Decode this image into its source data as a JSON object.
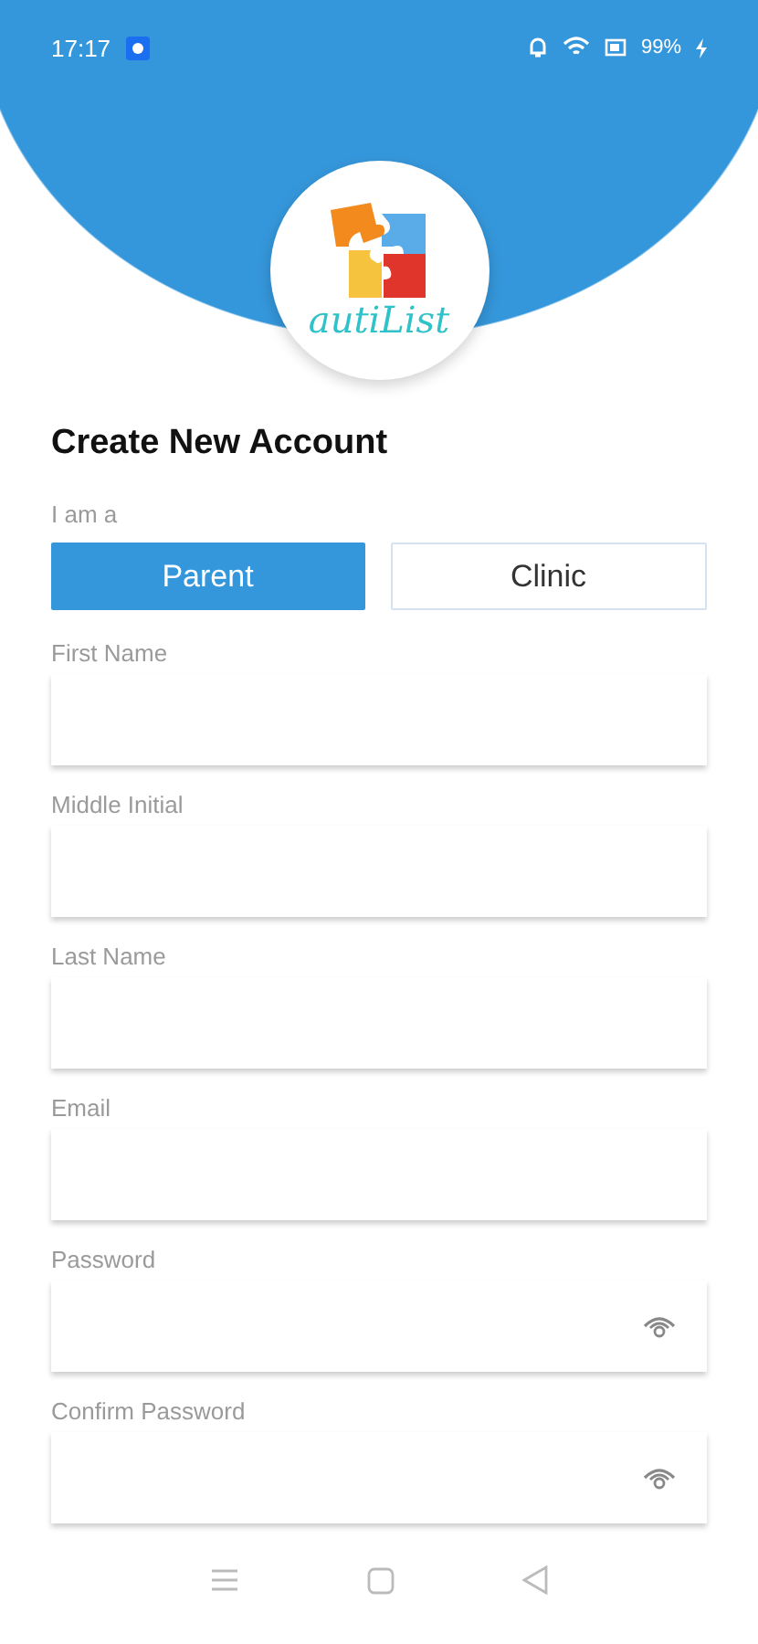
{
  "status_bar": {
    "time": "17:17",
    "battery": "99%"
  },
  "logo": {
    "text": "autiList"
  },
  "title": "Create New Account",
  "role": {
    "label": "I am a",
    "options": [
      {
        "label": "Parent",
        "selected": true
      },
      {
        "label": "Clinic",
        "selected": false
      }
    ]
  },
  "fields": [
    {
      "label": "First Name",
      "kind": "text"
    },
    {
      "label": "Middle Initial",
      "kind": "text"
    },
    {
      "label": "Last Name",
      "kind": "text"
    },
    {
      "label": "Email",
      "kind": "text"
    },
    {
      "label": "Password",
      "kind": "password"
    },
    {
      "label": "Confirm Password",
      "kind": "password"
    }
  ]
}
